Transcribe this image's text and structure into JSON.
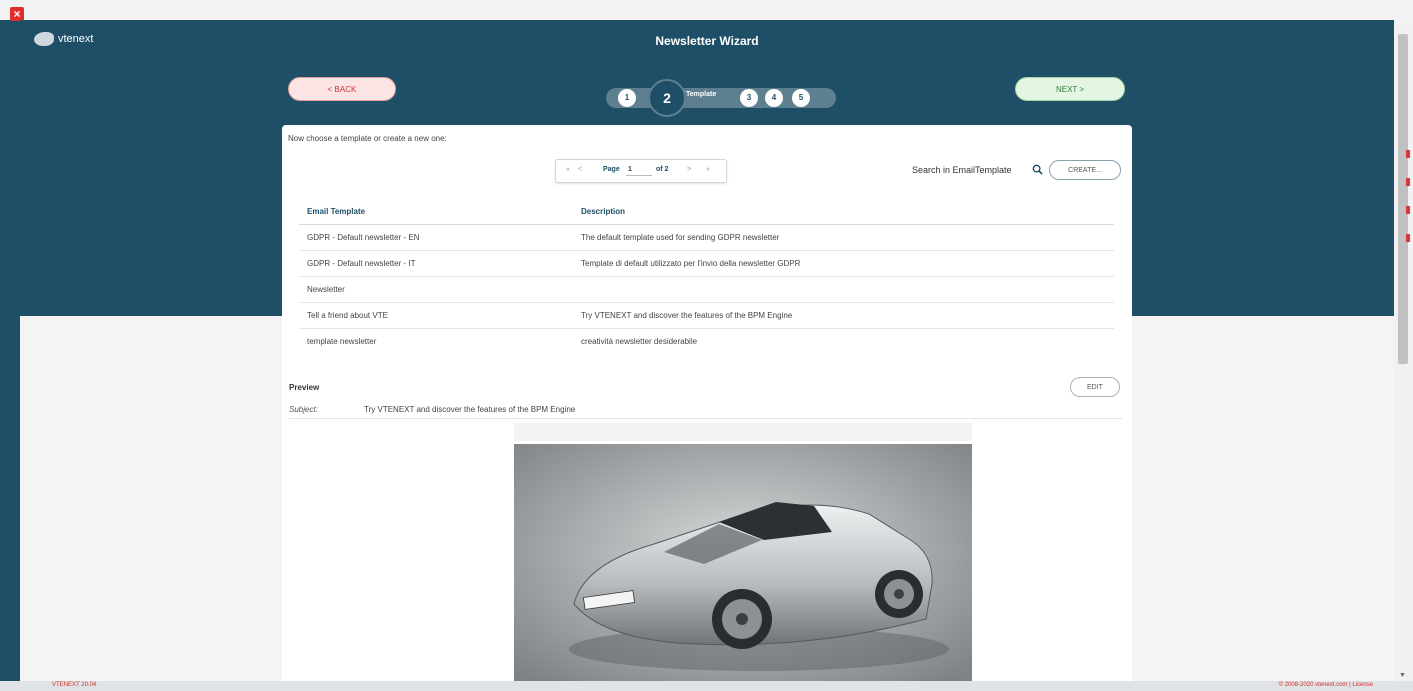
{
  "window": {
    "close_icon": "close-x-icon",
    "footer_left": "VTENEXT 20.04",
    "footer_right": "© 2008-2020 vtenext.com | License"
  },
  "header": {
    "logo_text": "vtenext",
    "title": "Newsletter Wizard",
    "back_label": "< BACK",
    "next_label": "NEXT >",
    "steps": [
      {
        "number": "1",
        "active": false
      },
      {
        "number": "2",
        "active": true,
        "label": "Template"
      },
      {
        "number": "3",
        "active": false
      },
      {
        "number": "4",
        "active": false
      },
      {
        "number": "5",
        "active": false
      }
    ]
  },
  "panel": {
    "instruction": "Now choose a template or create a new one:",
    "pager": {
      "first": "«",
      "prev": "<",
      "page_label": "Page",
      "page_value": "1",
      "of_label": "of 2",
      "next": ">",
      "last": "»"
    },
    "search_label": "Search in EmailTemplate",
    "create_label": "CREATE...",
    "table": {
      "headers": [
        "Email Template",
        "Description"
      ],
      "rows": [
        [
          "GDPR - Default newsletter - EN",
          "The default template used for sending GDPR newsletter"
        ],
        [
          "GDPR - Default newsletter - IT",
          "Template di default utilizzato per l'invio della newsletter GDPR"
        ],
        [
          "Newsletter",
          ""
        ],
        [
          "Tell a friend about VTE",
          "Try VTENEXT and discover the features of the BPM Engine"
        ],
        [
          "template newsletter",
          "creatività newsletter desiderabile"
        ]
      ]
    },
    "preview": {
      "title": "Preview",
      "edit_label": "EDIT",
      "subject_key": "Subject:",
      "subject_value": "Try VTENEXT and discover the features of the BPM Engine"
    }
  },
  "colors": {
    "header_bg": "#1e4f66",
    "back_accent": "#c43838",
    "next_accent": "#2e7d32"
  }
}
